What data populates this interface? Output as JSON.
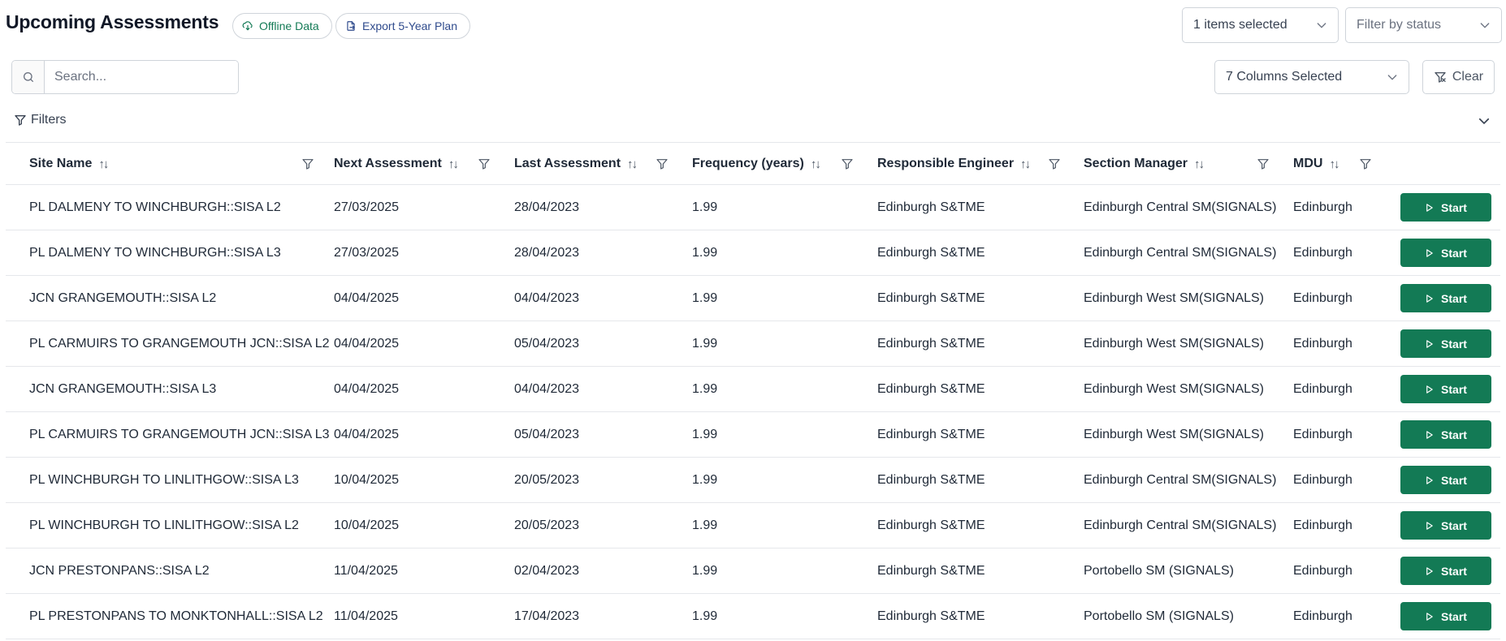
{
  "header": {
    "title": "Upcoming Assessments",
    "offline_label": "Offline Data",
    "export_label": "Export 5-Year Plan"
  },
  "controls": {
    "items_selected": "1 items selected",
    "filter_status_placeholder": "Filter by status",
    "columns_selected": "7 Columns Selected",
    "clear_label": "Clear",
    "search_placeholder": "Search...",
    "filters_label": "Filters"
  },
  "colors": {
    "accent": "#137a55",
    "export_text": "#2e4a8c",
    "border": "#cfd4da"
  },
  "icons": {
    "offline": "cloud-download-icon",
    "export": "file-export-icon",
    "search": "search-icon",
    "filter": "funnel-icon",
    "clear": "filter-clear-icon",
    "chevron": "chevron-down-icon",
    "sort": "sort-icon",
    "start": "play-icon"
  },
  "table": {
    "columns": [
      {
        "label": "Site Name"
      },
      {
        "label": "Next Assessment"
      },
      {
        "label": "Last Assessment"
      },
      {
        "label": "Frequency (years)"
      },
      {
        "label": "Responsible Engineer"
      },
      {
        "label": "Section Manager"
      },
      {
        "label": "MDU"
      }
    ],
    "sort_glyph": "↑↓",
    "action_label": "Start",
    "rows": [
      {
        "site": "PL DALMENY TO WINCHBURGH::SISA L2",
        "next": "27/03/2025",
        "last": "28/04/2023",
        "freq": "1.99",
        "engineer": "Edinburgh S&TME",
        "manager": "Edinburgh Central SM(SIGNALS)",
        "mdu": "Edinburgh"
      },
      {
        "site": "PL DALMENY TO WINCHBURGH::SISA L3",
        "next": "27/03/2025",
        "last": "28/04/2023",
        "freq": "1.99",
        "engineer": "Edinburgh S&TME",
        "manager": "Edinburgh Central SM(SIGNALS)",
        "mdu": "Edinburgh"
      },
      {
        "site": "JCN GRANGEMOUTH::SISA L2",
        "next": "04/04/2025",
        "last": "04/04/2023",
        "freq": "1.99",
        "engineer": "Edinburgh S&TME",
        "manager": "Edinburgh West SM(SIGNALS)",
        "mdu": "Edinburgh"
      },
      {
        "site": "PL CARMUIRS TO GRANGEMOUTH JCN::SISA L2",
        "next": "04/04/2025",
        "last": "05/04/2023",
        "freq": "1.99",
        "engineer": "Edinburgh S&TME",
        "manager": "Edinburgh West SM(SIGNALS)",
        "mdu": "Edinburgh"
      },
      {
        "site": "JCN GRANGEMOUTH::SISA L3",
        "next": "04/04/2025",
        "last": "04/04/2023",
        "freq": "1.99",
        "engineer": "Edinburgh S&TME",
        "manager": "Edinburgh West SM(SIGNALS)",
        "mdu": "Edinburgh"
      },
      {
        "site": "PL CARMUIRS TO GRANGEMOUTH JCN::SISA L3",
        "next": "04/04/2025",
        "last": "05/04/2023",
        "freq": "1.99",
        "engineer": "Edinburgh S&TME",
        "manager": "Edinburgh West SM(SIGNALS)",
        "mdu": "Edinburgh"
      },
      {
        "site": "PL WINCHBURGH TO LINLITHGOW::SISA L3",
        "next": "10/04/2025",
        "last": "20/05/2023",
        "freq": "1.99",
        "engineer": "Edinburgh S&TME",
        "manager": "Edinburgh Central SM(SIGNALS)",
        "mdu": "Edinburgh"
      },
      {
        "site": "PL WINCHBURGH TO LINLITHGOW::SISA L2",
        "next": "10/04/2025",
        "last": "20/05/2023",
        "freq": "1.99",
        "engineer": "Edinburgh S&TME",
        "manager": "Edinburgh Central SM(SIGNALS)",
        "mdu": "Edinburgh"
      },
      {
        "site": "JCN PRESTONPANS::SISA L2",
        "next": "11/04/2025",
        "last": "02/04/2023",
        "freq": "1.99",
        "engineer": "Edinburgh S&TME",
        "manager": "Portobello SM (SIGNALS)",
        "mdu": "Edinburgh"
      },
      {
        "site": "PL PRESTONPANS TO MONKTONHALL::SISA L2",
        "next": "11/04/2025",
        "last": "17/04/2023",
        "freq": "1.99",
        "engineer": "Edinburgh S&TME",
        "manager": "Portobello SM (SIGNALS)",
        "mdu": "Edinburgh"
      }
    ]
  }
}
